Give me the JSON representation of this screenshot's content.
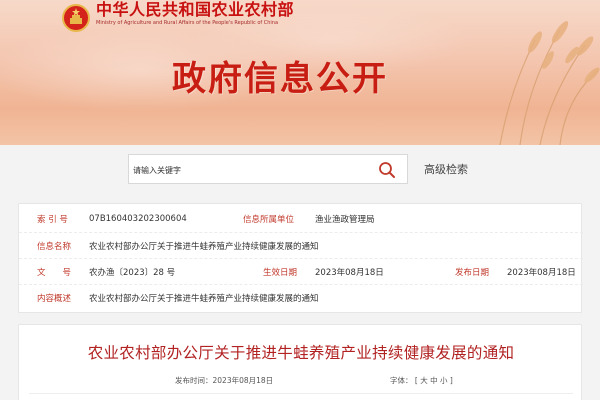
{
  "header": {
    "ministry_cn": "中华人民共和国农业农村部",
    "ministry_en": "Ministry of Agriculture and Rural Affairs of the People's Republic of China",
    "section_title": "政府信息公开",
    "emblem_icon": "national-emblem-icon",
    "colors": {
      "brand_red": "#c81d12",
      "banner_bg": "#f4c6b0"
    }
  },
  "search": {
    "placeholder": "请输入关键字",
    "search_icon": "search-icon",
    "advanced_label": "高级检索"
  },
  "info": {
    "index_label": "索 引 号",
    "index_value": "07B160403202300604",
    "org_label": "信息所属单位",
    "org_value": "渔业渔政管理局",
    "name_label": "信息名称",
    "name_value": "农业农村部办公厅关于推进牛蛙养殖产业持续健康发展的通知",
    "doc_label": "文　　号",
    "doc_value": "农办渔〔2023〕28 号",
    "effective_label": "生效日期",
    "effective_value": "2023年08月18日",
    "publish_label": "发布日期",
    "publish_value": "2023年08月18日",
    "summary_label": "内容概述",
    "summary_value": "农业农村部办公厅关于推进牛蛙养殖产业持续健康发展的通知"
  },
  "article": {
    "title": "农业农村部办公厅关于推进牛蛙养殖产业持续健康发展的通知",
    "pub_time": "发布时间：2023年08月18日",
    "font_label": "字体：",
    "font_open": "[",
    "font_large": "大",
    "font_medium": "中",
    "font_small": "小",
    "font_close": "]"
  }
}
